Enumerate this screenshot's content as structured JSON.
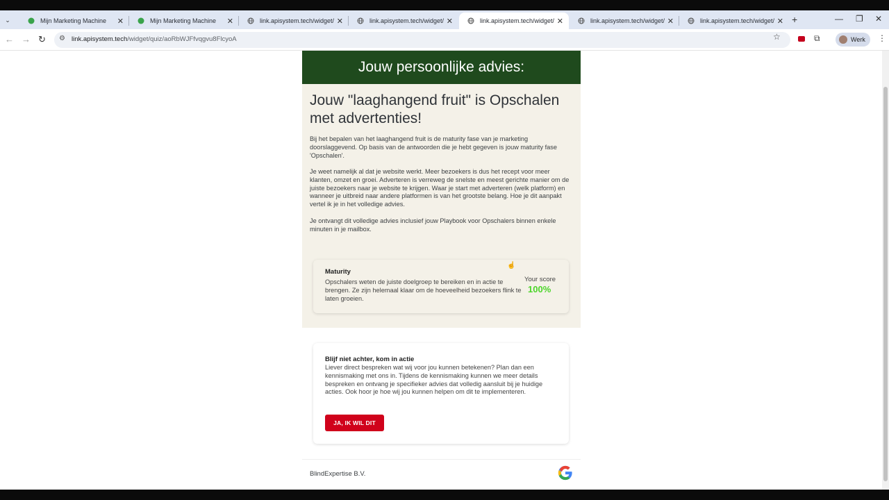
{
  "browser": {
    "tabs": [
      {
        "title": "Mijn Marketing Machine",
        "icon": "green-mm-favicon",
        "active": false
      },
      {
        "title": "Mijn Marketing Machine",
        "icon": "green-mm-favicon",
        "active": false
      },
      {
        "title": "link.apisystem.tech/widget/quiz",
        "icon": "globe-icon",
        "active": false
      },
      {
        "title": "link.apisystem.tech/widget/quiz",
        "icon": "globe-icon",
        "active": false
      },
      {
        "title": "link.apisystem.tech/widget/quiz",
        "icon": "globe-icon",
        "active": true
      },
      {
        "title": "link.apisystem.tech/widget/quiz",
        "icon": "globe-icon",
        "active": false
      },
      {
        "title": "link.apisystem.tech/widget/quiz",
        "icon": "globe-icon",
        "active": false
      }
    ],
    "url_host": "link.apisystem.tech",
    "url_path": "/widget/quiz/aoRbWJFfvqgvu8FlcyoA",
    "profile_label": "Werk"
  },
  "page": {
    "header_title": "Jouw persoonlijke advies:",
    "headline": "Jouw \"laaghangend fruit\" is Opschalen met advertenties!",
    "paragraphs": [
      "Bij het bepalen van het laaghangend fruit is de maturity fase van je marketing doorslaggevend. Op basis van de antwoorden die je hebt gegeven is jouw maturity fase 'Opschalen'.",
      "Je weet namelijk al dat je website werkt. Meer bezoekers is dus het recept voor meer klanten, omzet en groei. Adverteren is verreweg de snelste en meest gerichte manier om de juiste bezoekers naar je website te krijgen. Waar je start met adverteren (welk platform) en wanneer je uitbreid naar andere platformen is van het grootste belang. Hoe je dit aanpakt vertel ik je in het volledige advies.",
      "Je ontvangt dit volledige advies inclusief jouw Playbook voor Opschalers binnen enkele minuten in je mailbox."
    ],
    "maturity": {
      "title": "Maturity",
      "text": "Opschalers weten de juiste doelgroep te bereiken en in actie te brengen. Ze zijn helemaal klaar om de hoeveelheid bezoekers flink te laten groeien.",
      "score_label": "Your score",
      "score_value": "100%"
    },
    "cta": {
      "title": "Blijf niet achter, kom in actie",
      "text": "Liever direct bespreken wat wij voor jou kunnen betekenen? Plan dan een kennismaking met ons in. Tijdens de kennismaking kunnen we meer details bespreken en ontvang je specifieker advies dat volledig aansluit bij je huidige acties. Ook hoor je hoe wij jou kunnen helpen om dit te implementeren.",
      "button_label": "JA, IK WIL DIT"
    },
    "footer_company": "BlindExpertise B.V."
  },
  "colors": {
    "header_green": "#1f4a1d",
    "beige": "#f4f1e8",
    "cta_red": "#d0021b",
    "score_green": "#4cd52a"
  }
}
